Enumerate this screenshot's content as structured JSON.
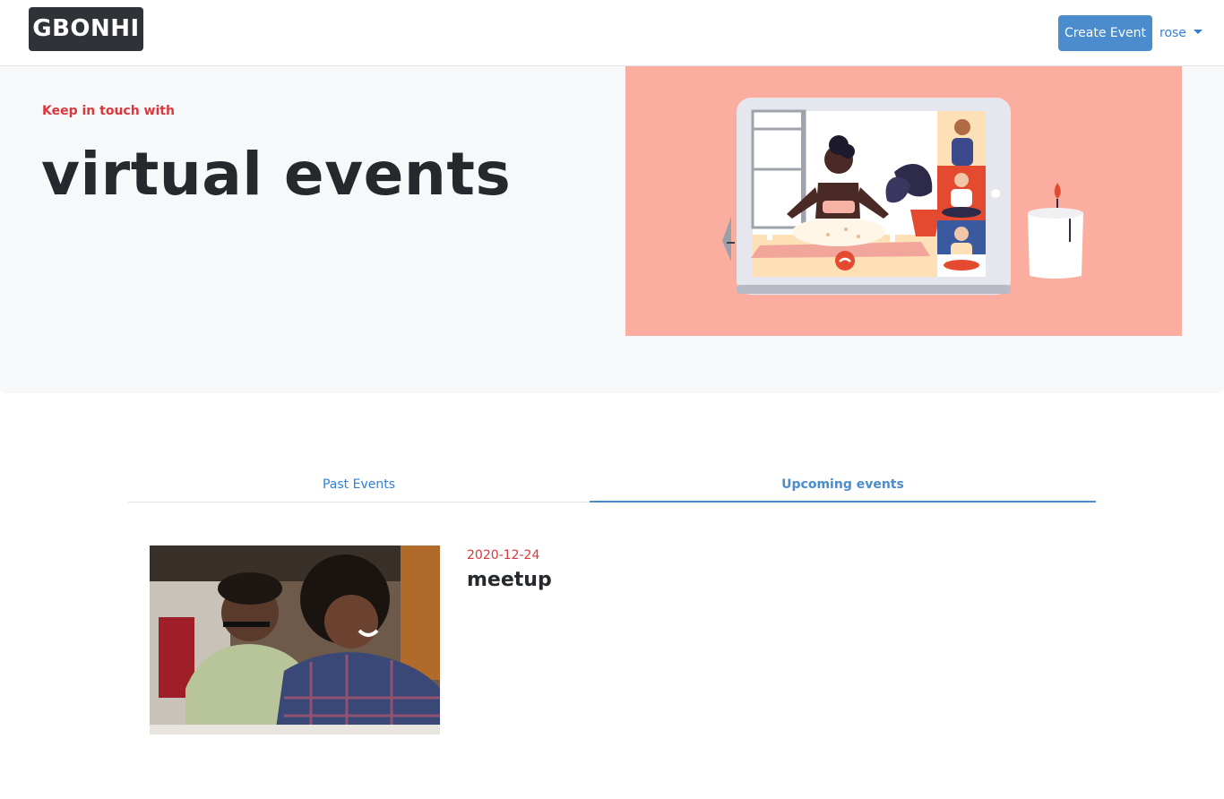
{
  "navbar": {
    "brand": "GBONHI",
    "create_event_label": "Create Event",
    "user_name": "rose"
  },
  "hero": {
    "kicker": "Keep in touch with",
    "headline": "virtual events",
    "illustration_bg": "#fbae9f"
  },
  "tabs": [
    {
      "label": "Past Events",
      "active": false
    },
    {
      "label": "Upcoming events",
      "active": true
    }
  ],
  "events": [
    {
      "date": "2020-12-24",
      "title": "meetup"
    }
  ],
  "colors": {
    "accent": "#4a8ccd",
    "link": "#2f7fd6",
    "danger": "#d9383c",
    "brand_bg": "#2f3338"
  }
}
